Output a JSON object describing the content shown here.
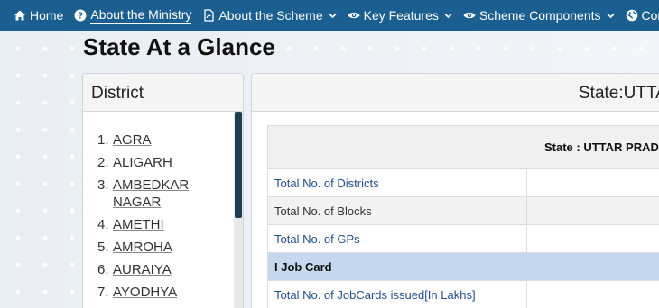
{
  "nav": {
    "items": [
      {
        "label": "Home",
        "icon": "home-icon"
      },
      {
        "label": "About the Ministry",
        "icon": "question-circle-icon",
        "active": true
      },
      {
        "label": "About the Scheme",
        "icon": "pdf-file-icon",
        "dropdown": true
      },
      {
        "label": "Key Features",
        "icon": "eye-icon",
        "dropdown": true
      },
      {
        "label": "Scheme Components",
        "icon": "eye-icon",
        "dropdown": true
      },
      {
        "label": "Cont",
        "icon": "globe-icon"
      }
    ]
  },
  "page": {
    "title": "State At a Glance"
  },
  "district_panel": {
    "heading": "District",
    "districts": [
      {
        "num": "1.",
        "name": "AGRA"
      },
      {
        "num": "2.",
        "name": "ALIGARH"
      },
      {
        "num": "3.",
        "name": "AMBEDKAR NAGAR"
      },
      {
        "num": "4.",
        "name": "AMETHI"
      },
      {
        "num": "5.",
        "name": "AMROHA"
      },
      {
        "num": "6.",
        "name": "AURAIYA"
      },
      {
        "num": "7.",
        "name": "AYODHYA"
      }
    ]
  },
  "state_panel": {
    "heading": "State:UTTA",
    "table_header": "State : UTTAR PRADI",
    "rows": [
      {
        "label": "Total No. of Districts",
        "value": ""
      },
      {
        "label": "Total No. of Blocks",
        "value": ""
      },
      {
        "label": "Total No. of GPs",
        "value": ""
      }
    ],
    "section": "I Job Card",
    "section_rows": [
      {
        "label": "Total No. of JobCards issued[In Lakhs]",
        "value": ""
      }
    ]
  },
  "colors": {
    "nav_bg": "#1a5f8f",
    "section_bg": "#c5d8ee",
    "link": "#1f4f8a",
    "scroll_thumb": "#1e3f4f"
  }
}
